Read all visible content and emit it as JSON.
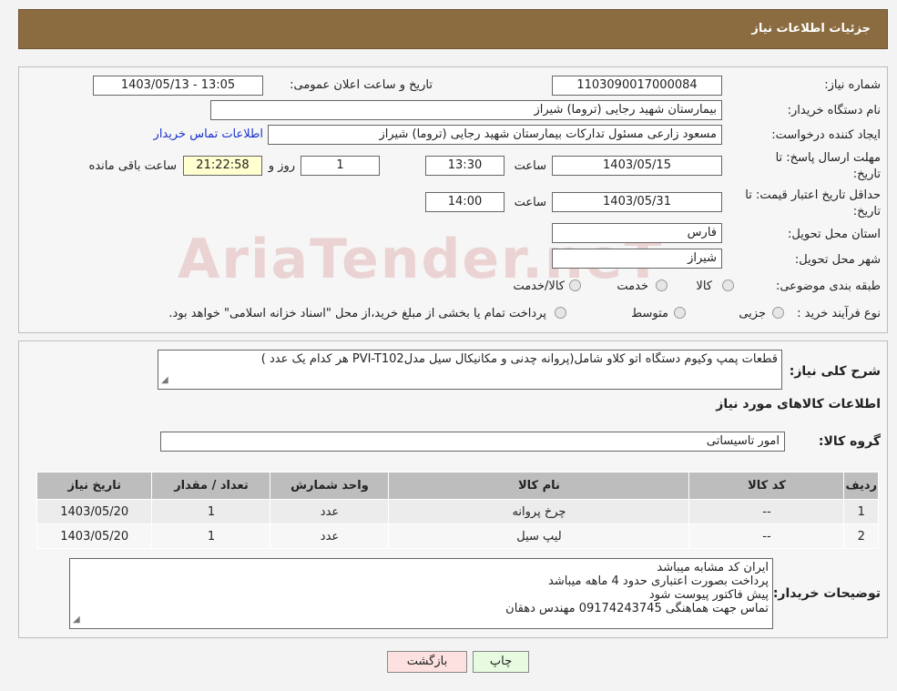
{
  "header": {
    "title": "جزئیات اطلاعات نیاز"
  },
  "fields": {
    "need_number_label": "شماره نیاز:",
    "need_number": "1103090017000084",
    "announce_label": "تاریخ و ساعت اعلان عمومی:",
    "announce_value": "1403/05/13 - 13:05",
    "buyer_org_label": "نام دستگاه خریدار:",
    "buyer_org": "بیمارستان شهید رجایی (تروما) شیراز",
    "creator_label": "ایجاد کننده درخواست:",
    "creator": "مسعود زارعی مسئول تدارکات بیمارستان شهید رجایی (تروما) شیراز",
    "contact_link": "اطلاعات تماس خریدار",
    "deadline_label": "مهلت ارسال پاسخ: تا تاریخ:",
    "deadline_date": "1403/05/15",
    "time_label": "ساعت",
    "deadline_time": "13:30",
    "days_value": "1",
    "days_label": "روز و",
    "remaining_time": "21:22:58",
    "remaining_label": "ساعت باقی مانده",
    "validity_label": "حداقل تاریخ اعتبار قیمت: تا تاریخ:",
    "validity_date": "1403/05/31",
    "validity_time": "14:00",
    "province_label": "استان محل تحویل:",
    "province": "فارس",
    "city_label": "شهر محل تحویل:",
    "city": "شیراز",
    "category_label": "طبقه بندی موضوعی:",
    "category_options": [
      "کالا",
      "خدمت",
      "کالا/خدمت"
    ],
    "process_label": "نوع فرآیند خرید :",
    "process_options": [
      "جزیی",
      "متوسط"
    ],
    "process_note": "پرداخت تمام یا بخشی از مبلغ خرید،از محل \"اسناد خزانه اسلامی\" خواهد بود."
  },
  "description": {
    "label": "شرح کلی نیاز:",
    "text": "قطعات پمپ وکیوم دستگاه اتو کلاو شامل(پروانه  چدنی و مکانیکال سیل مدلPVI-T102 هر کدام یک عدد )"
  },
  "goods": {
    "section_title": "اطلاعات کالاهای مورد نیاز",
    "group_label": "گروه کالا:",
    "group_value": "امور تاسیساتی"
  },
  "table": {
    "headers": [
      "ردیف",
      "کد کالا",
      "نام کالا",
      "واحد شمارش",
      "تعداد / مقدار",
      "تاریخ نیاز"
    ],
    "rows": [
      [
        "1",
        "--",
        "چرخ پروانه",
        "عدد",
        "1",
        "1403/05/20"
      ],
      [
        "2",
        "--",
        "لیپ سیل",
        "عدد",
        "1",
        "1403/05/20"
      ]
    ]
  },
  "buyer_notes": {
    "label": "توضیحات خریدار:",
    "lines": [
      "ایران کد مشابه میباشد",
      "پرداخت بصورت اعتباری حدود 4 ماهه میباشد",
      "پیش فاکتور پیوست  شود",
      "تماس جهت هماهنگی 09174243745 مهندس دهقان"
    ]
  },
  "buttons": {
    "print": "چاپ",
    "back": "بازگشت"
  },
  "watermark": "AriaTender.neT",
  "colors": {
    "header_bg": "#8b6c40",
    "back_button_bg": "#fde0e0",
    "print_button_bg": "#e6fbe0"
  }
}
